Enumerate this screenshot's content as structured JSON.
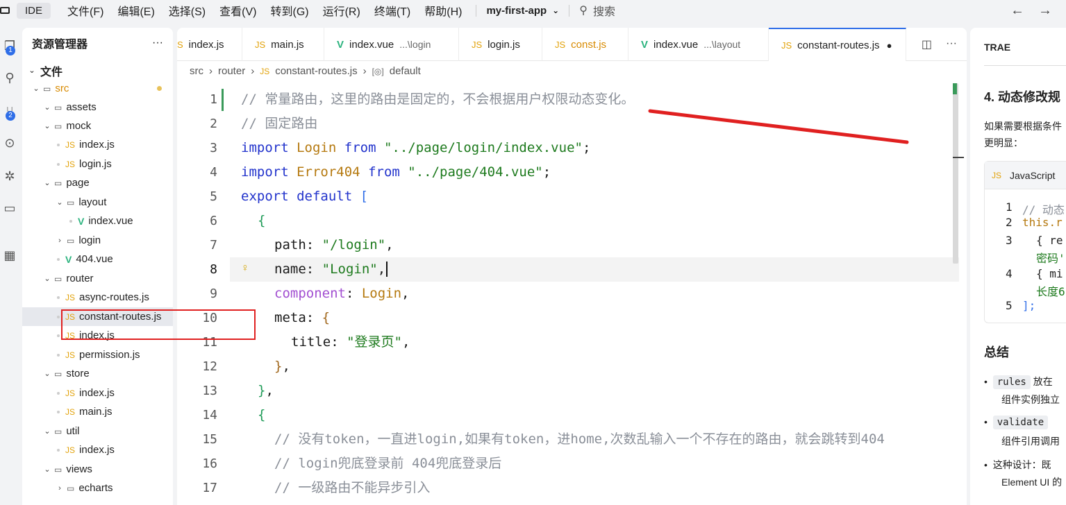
{
  "titlebar": {
    "ide_label": "IDE",
    "menus": [
      "文件(F)",
      "编辑(E)",
      "选择(S)",
      "查看(V)",
      "转到(G)",
      "运行(R)",
      "终端(T)",
      "帮助(H)"
    ],
    "project": "my-first-app",
    "search_placeholder": "搜索",
    "back_icon": "arrow-left-icon",
    "forward_icon": "arrow-right-icon"
  },
  "activity": {
    "explorer_badge": "1",
    "scm_badge": "2"
  },
  "explorer": {
    "title": "资源管理器",
    "more": "···",
    "section": "文件",
    "rows": [
      {
        "label": "src",
        "kind": "folder"
      },
      {
        "label": "assets",
        "kind": "folder"
      },
      {
        "label": "mock",
        "kind": "folder"
      },
      {
        "label": "index.js",
        "kind": "js"
      },
      {
        "label": "login.js",
        "kind": "js"
      },
      {
        "label": "page",
        "kind": "folder"
      },
      {
        "label": "layout",
        "kind": "folder"
      },
      {
        "label": "index.vue",
        "kind": "vue"
      },
      {
        "label": "login",
        "kind": "folder"
      },
      {
        "label": "404.vue",
        "kind": "vue"
      },
      {
        "label": "router",
        "kind": "folder"
      },
      {
        "label": "async-routes.js",
        "kind": "js"
      },
      {
        "label": "constant-routes.js",
        "kind": "js"
      },
      {
        "label": "index.js",
        "kind": "js"
      },
      {
        "label": "permission.js",
        "kind": "js"
      },
      {
        "label": "store",
        "kind": "folder"
      },
      {
        "label": "index.js",
        "kind": "js"
      },
      {
        "label": "main.js",
        "kind": "js"
      },
      {
        "label": "util",
        "kind": "folder"
      },
      {
        "label": "index.js",
        "kind": "js"
      },
      {
        "label": "views",
        "kind": "folder"
      },
      {
        "label": "echarts",
        "kind": "folder"
      }
    ]
  },
  "tabs": [
    {
      "label": "index.js",
      "kind": "js",
      "hint": ""
    },
    {
      "label": "main.js",
      "kind": "js",
      "hint": ""
    },
    {
      "label": "index.vue",
      "kind": "vue",
      "hint": "...\\login"
    },
    {
      "label": "login.js",
      "kind": "js",
      "hint": ""
    },
    {
      "label": "const.js",
      "kind": "js",
      "hint": ""
    },
    {
      "label": "index.vue",
      "kind": "vue",
      "hint": "...\\layout"
    },
    {
      "label": "constant-routes.js",
      "kind": "js",
      "hint": ""
    }
  ],
  "breadcrumb": [
    "src",
    "router",
    "constant-routes.js",
    "default"
  ],
  "editor": {
    "line_numbers": [
      "1",
      "2",
      "3",
      "4",
      "5",
      "6",
      "7",
      "8",
      "9",
      "10",
      "11",
      "12",
      "13",
      "14",
      "15",
      "16",
      "17"
    ],
    "lines": {
      "l1": "// 常量路由，这里的路由是固定的，不会根据用户权限动态变化。",
      "l2": "// 固定路由",
      "l3_kw": "import",
      "l3_id": "Login",
      "l3_from": "from",
      "l3_str": "\"../page/login/index.vue\"",
      "l4_kw": "import",
      "l4_id": "Error404",
      "l4_from": "from",
      "l4_str": "\"../page/404.vue\"",
      "l5_kw": "export default",
      "l7_key": "path",
      "l7_val": "\"/login\"",
      "l8_key": "name",
      "l8_val": "\"Login\"",
      "l9_key": "component",
      "l9_val": "Login",
      "l10_key": "meta",
      "l11_key": "title",
      "l11_val": "\"登录页\"",
      "l15": "// 没有token，一直进login,如果有token，进home,次数乱输入一个不存在的路由，就会跳转到404",
      "l16": "// login兜底登录前 404兜底登录后",
      "l17": "// 一级路由不能异步引入"
    }
  },
  "trae": {
    "title": "TRAE",
    "heading": "4. 动态修改规",
    "para1": "如果需要根据条件",
    "para2": "更明显：",
    "code_lang": "JavaScript",
    "code_lines": [
      {
        "n": "1",
        "text": "// 动态"
      },
      {
        "n": "2",
        "text": "this.r"
      },
      {
        "n": "3",
        "text": "{ re"
      },
      {
        "n": "",
        "text": "密码'"
      },
      {
        "n": "4",
        "text": "{ mi"
      },
      {
        "n": "",
        "text": "长度6"
      },
      {
        "n": "5",
        "text": "];"
      }
    ],
    "summary": "总结",
    "bullet1_chip": "rules",
    "bullet1_text": "放在",
    "bullet1_line2": "组件实例独立",
    "bullet2_chip": "validate",
    "bullet2_line2": "组件引用调用",
    "bullet3": "这种设计：既",
    "bullet3_line2": "Element UI 的"
  },
  "colors": {
    "accent": "#2f6ee8",
    "annotation_red": "#e02020"
  }
}
